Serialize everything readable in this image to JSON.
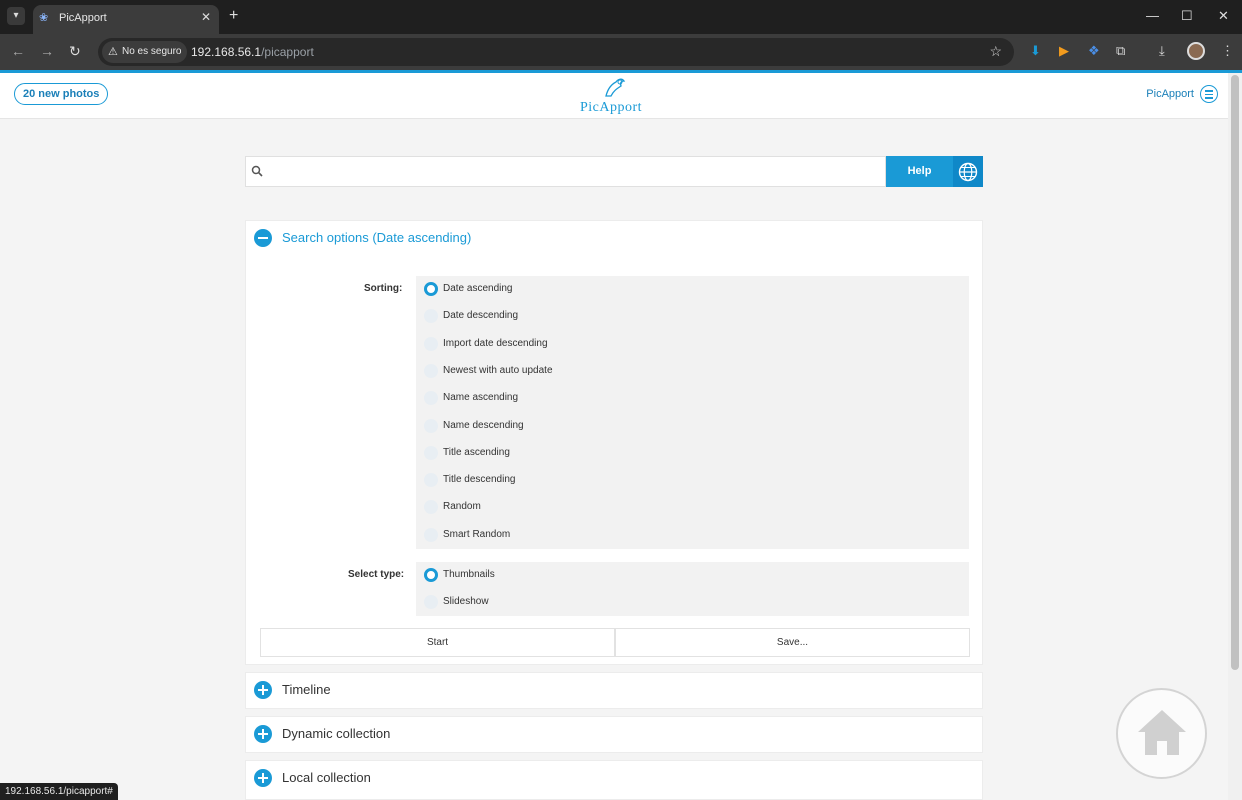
{
  "browser": {
    "tab_title": "PicApport",
    "security_label": "No es seguro",
    "url_host": "192.168.56.1",
    "url_path": "/picapport",
    "status_url": "192.168.56.1/picapport#"
  },
  "header": {
    "new_photos": "20 new photos",
    "logo_text": "PicApport",
    "menu_label": "PicApport"
  },
  "search": {
    "placeholder": "",
    "help_label": "Help"
  },
  "search_options": {
    "title": "Search options (Date ascending)",
    "sorting_label": "Sorting:",
    "sorting_options": [
      "Date ascending",
      "Date descending",
      "Import date descending",
      "Newest with auto update",
      "Name ascending",
      "Name descending",
      "Title ascending",
      "Title descending",
      "Random",
      "Smart Random"
    ],
    "sorting_selected": "Date ascending",
    "select_type_label": "Select type:",
    "type_options": [
      "Thumbnails",
      "Slideshow"
    ],
    "type_selected": "Thumbnails",
    "start_label": "Start",
    "save_label": "Save..."
  },
  "collapsed_panels": [
    "Timeline",
    "Dynamic collection",
    "Local collection"
  ],
  "colors": {
    "accent": "#1a9ad6",
    "accent_dark": "#0f88c8"
  }
}
